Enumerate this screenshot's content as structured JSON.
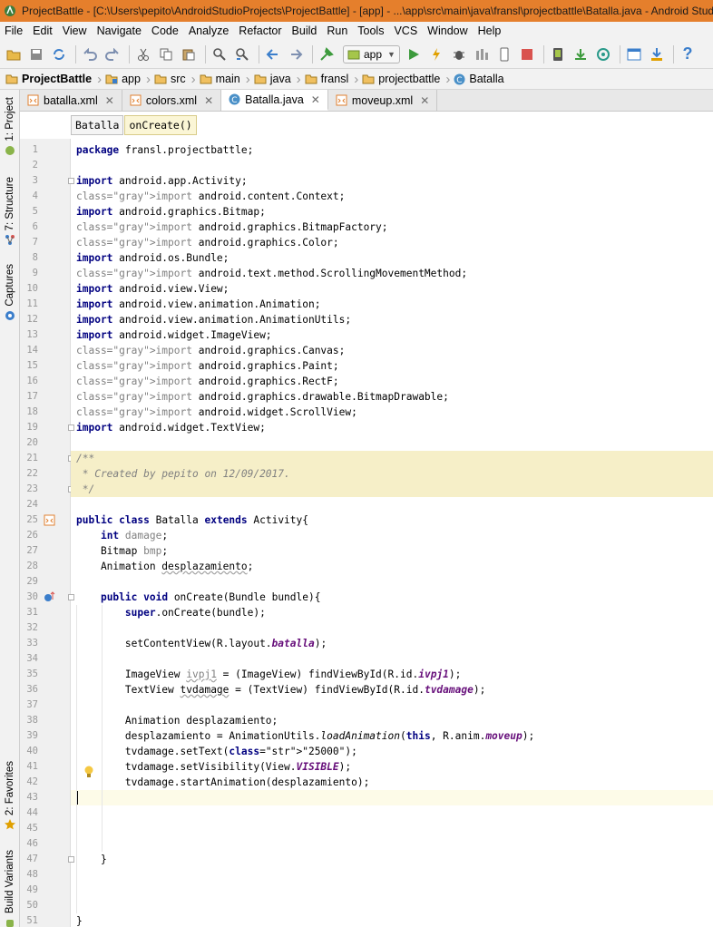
{
  "window": {
    "title": "ProjectBattle - [C:\\Users\\pepito\\AndroidStudioProjects\\ProjectBattle] - [app] - ...\\app\\src\\main\\java\\fransl\\projectbattle\\Batalla.java - Android Studio"
  },
  "menu": [
    "File",
    "Edit",
    "View",
    "Navigate",
    "Code",
    "Analyze",
    "Refactor",
    "Build",
    "Run",
    "Tools",
    "VCS",
    "Window",
    "Help"
  ],
  "toolbar": {
    "run_config": "app"
  },
  "breadcrumbs": [
    "ProjectBattle",
    "app",
    "src",
    "main",
    "java",
    "fransl",
    "projectbattle",
    "Batalla"
  ],
  "sidebar": {
    "tabs": [
      "1: Project",
      "7: Structure",
      "Captures",
      "2: Favorites",
      "Build Variants"
    ]
  },
  "tabs": [
    {
      "label": "batalla.xml",
      "active": false
    },
    {
      "label": "colors.xml",
      "active": false
    },
    {
      "label": "Batalla.java",
      "active": true
    },
    {
      "label": "moveup.xml",
      "active": false
    }
  ],
  "editor_breadcrumb": [
    "Batalla",
    "onCreate()"
  ],
  "code_lines": [
    "package fransl.projectbattle;",
    "",
    "import android.app.Activity;",
    "import android.content.Context;",
    "import android.graphics.Bitmap;",
    "import android.graphics.BitmapFactory;",
    "import android.graphics.Color;",
    "import android.os.Bundle;",
    "import android.text.method.ScrollingMovementMethod;",
    "import android.view.View;",
    "import android.view.animation.Animation;",
    "import android.view.animation.AnimationUtils;",
    "import android.widget.ImageView;",
    "import android.graphics.Canvas;",
    "import android.graphics.Paint;",
    "import android.graphics.RectF;",
    "import android.graphics.drawable.BitmapDrawable;",
    "import android.widget.ScrollView;",
    "import android.widget.TextView;",
    "",
    "/**",
    " * Created by pepito on 12/09/2017.",
    " */",
    "",
    "public class Batalla extends Activity{",
    "    int damage;",
    "    Bitmap bmp;",
    "    Animation desplazamiento;",
    "",
    "    public void onCreate(Bundle bundle){",
    "        super.onCreate(bundle);",
    "",
    "        setContentView(R.layout.batalla);",
    "",
    "        ImageView ivpj1 = (ImageView) findViewById(R.id.ivpj1);",
    "        TextView tvdamage = (TextView) findViewById(R.id.tvdamage);",
    "",
    "        Animation desplazamiento;",
    "        desplazamiento = AnimationUtils.loadAnimation(this, R.anim.moveup);",
    "        tvdamage.setText(\"25000\");",
    "        tvdamage.setVisibility(View.VISIBLE);",
    "        tvdamage.startAnimation(desplazamiento);",
    "",
    "",
    "",
    "",
    "    }",
    "",
    "",
    "",
    "}"
  ],
  "unused_import_lines": [
    4,
    6,
    7,
    9,
    14,
    15,
    16,
    17,
    18
  ],
  "colors": {
    "titlebar": "#e57f2c",
    "keyword": "#000080",
    "string": "#008000",
    "field": "#660e7a",
    "comment": "#808080",
    "doc_highlight": "#f6efc8"
  }
}
